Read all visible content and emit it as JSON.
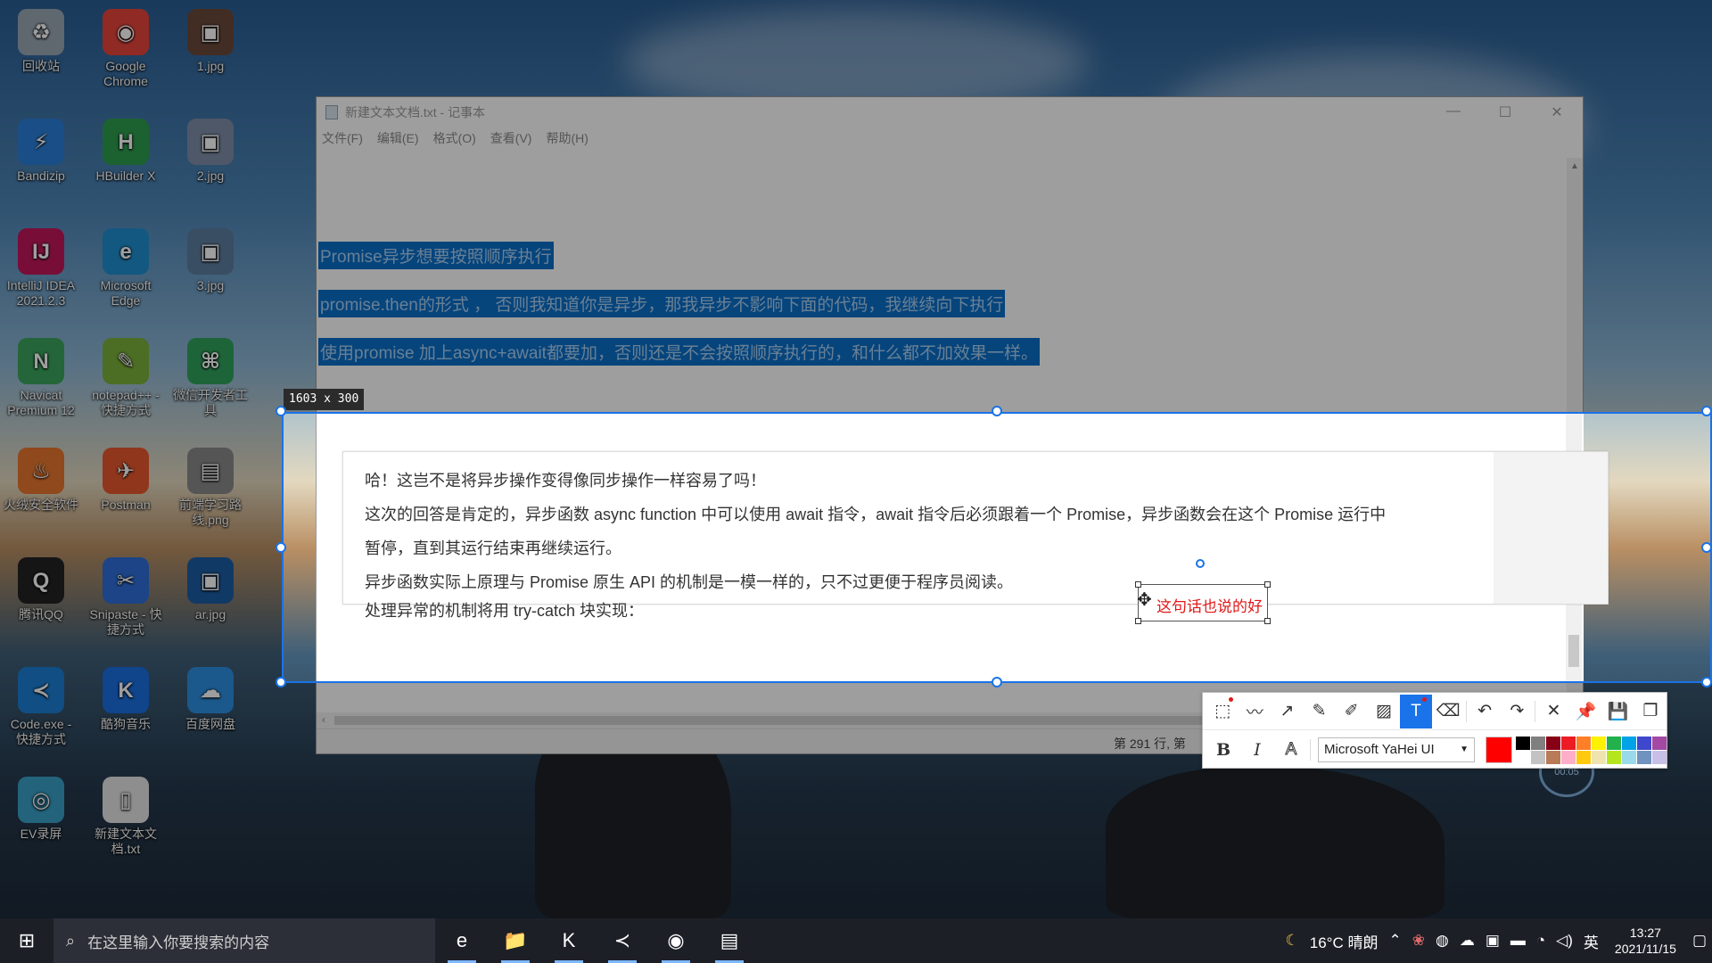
{
  "desktop": {
    "icons": [
      {
        "label": "回收站",
        "glyph": "♻",
        "color": "#9aa7b4"
      },
      {
        "label": "Google Chrome",
        "glyph": "◉",
        "color": "#e8453c"
      },
      {
        "label": "1.jpg",
        "glyph": "▣",
        "color": "#6b4a3a"
      },
      {
        "label": "Bandizip",
        "glyph": "⚡",
        "color": "#2b7fd8"
      },
      {
        "label": "HBuilder X",
        "glyph": "H",
        "color": "#2e9e4f"
      },
      {
        "label": "2.jpg",
        "glyph": "▣",
        "color": "#7e8fa8"
      },
      {
        "label": "IntelliJ IDEA 2021.2.3",
        "glyph": "IJ",
        "color": "#c2185b"
      },
      {
        "label": "Microsoft Edge",
        "glyph": "e",
        "color": "#1f8fcf"
      },
      {
        "label": "3.jpg",
        "glyph": "▣",
        "color": "#5d7ea0"
      },
      {
        "label": "Navicat Premium 12",
        "glyph": "N",
        "color": "#3aa55d"
      },
      {
        "label": "notepad++ - 快捷方式",
        "glyph": "✎",
        "color": "#7bb03a"
      },
      {
        "label": "微信开发者工具",
        "glyph": "⌘",
        "color": "#2fa35c"
      },
      {
        "label": "火绒安全软件",
        "glyph": "♨",
        "color": "#e8772e"
      },
      {
        "label": "Postman",
        "glyph": "✈",
        "color": "#e8582e"
      },
      {
        "label": "前端学习路线.png",
        "glyph": "▤",
        "color": "#8a8a8a"
      },
      {
        "label": "腾讯QQ",
        "glyph": "Q",
        "color": "#222222"
      },
      {
        "label": "Snipaste - 快捷方式",
        "glyph": "✂",
        "color": "#2e6fd8"
      },
      {
        "label": "ar.jpg",
        "glyph": "▣",
        "color": "#1c5da4"
      },
      {
        "label": "Code.exe - 快捷方式",
        "glyph": "≺",
        "color": "#1a7fd4"
      },
      {
        "label": "酷狗音乐",
        "glyph": "K",
        "color": "#1a6fe0"
      },
      {
        "label": "百度网盘",
        "glyph": "☁",
        "color": "#2d8fe0"
      },
      {
        "label": "EV录屏",
        "glyph": "◎",
        "color": "#3aa0c8"
      },
      {
        "label": "新建文本文档.txt",
        "glyph": "▯",
        "color": "#e6e6e6"
      }
    ]
  },
  "notepad": {
    "title": "新建文本文档.txt - 记事本",
    "menu": [
      "文件(F)",
      "编辑(E)",
      "格式(O)",
      "查看(V)",
      "帮助(H)"
    ],
    "selected_lines": [
      "Promise异步想要按照顺序执行",
      "promise.then的形式 ， 否则我知道你是异步，那我异步不影响下面的代码，我继续向下执行",
      "使用promise   加上async+await都要加，否则还是不会按照顺序执行的，和什么都不加效果一样。"
    ],
    "status": "第 291 行, 第"
  },
  "capture": {
    "size_label": "1603 x 300",
    "pasted_lines": [
      "哈！这岂不是将异步操作变得像同步操作一样容易了吗！",
      "这次的回答是肯定的，异步函数 async function 中可以使用 await 指令，await 指令后必须跟着一个 Promise，异步函数会在这个 Promise 运行中",
      "暂停，直到其运行结束再继续运行。",
      "异步函数实际上原理与 Promise 原生 API 的机制是一模一样的，只不过更便于程序员阅读。",
      "处理异常的机制将用 try-catch 块实现："
    ],
    "annotation_text": "这句话也说的好",
    "annotation_color": "#e01818"
  },
  "toolbar": {
    "tools": [
      {
        "name": "rect-shape-tool",
        "glyph": "⬚",
        "dot": true
      },
      {
        "name": "polyline-tool",
        "glyph": "〰",
        "dot": false
      },
      {
        "name": "arrow-tool",
        "glyph": "↗",
        "dot": false
      },
      {
        "name": "pencil-tool",
        "glyph": "✎",
        "dot": false
      },
      {
        "name": "marker-tool",
        "glyph": "✐",
        "dot": false
      },
      {
        "name": "mosaic-tool",
        "glyph": "▨",
        "dot": false
      },
      {
        "name": "text-tool",
        "glyph": "T",
        "dot": true,
        "active": true
      },
      {
        "name": "eraser-tool",
        "glyph": "⌫",
        "dot": false
      }
    ],
    "actions": [
      {
        "name": "undo-button",
        "glyph": "↶"
      },
      {
        "name": "redo-button",
        "glyph": "↷"
      },
      {
        "name": "cancel-button",
        "glyph": "✕"
      },
      {
        "name": "pin-button",
        "glyph": "📌"
      },
      {
        "name": "save-button",
        "glyph": "💾"
      },
      {
        "name": "copy-button",
        "glyph": "❐"
      }
    ],
    "bold_label": "B",
    "italic_label": "I",
    "outline_label": "A",
    "font": "Microsoft YaHei UI",
    "current_color": "#ff0000",
    "palette": [
      "#000000",
      "#7f7f7f",
      "#880015",
      "#ed1c24",
      "#ff7f27",
      "#fff200",
      "#22b14c",
      "#00a2e8",
      "#3f48cc",
      "#a349a4",
      "#ffffff",
      "#c3c3c3",
      "#b97a57",
      "#ffaec9",
      "#ffc90e",
      "#efe4b0",
      "#b5e61d",
      "#99d9ea",
      "#7092be",
      "#c8bfe7"
    ]
  },
  "recorder_badge": "00:05",
  "taskbar": {
    "search_placeholder": "在这里输入你要搜索的内容",
    "apps": [
      {
        "name": "edge",
        "glyph": "e"
      },
      {
        "name": "file-explorer",
        "glyph": "📁"
      },
      {
        "name": "kugou",
        "glyph": "K"
      },
      {
        "name": "vscode",
        "glyph": "≺"
      },
      {
        "name": "chrome",
        "glyph": "◉"
      },
      {
        "name": "notepad",
        "glyph": "▤"
      }
    ],
    "weather": "16°C 晴朗",
    "ime": "英",
    "time": "13:27",
    "date": "2021/11/15"
  }
}
